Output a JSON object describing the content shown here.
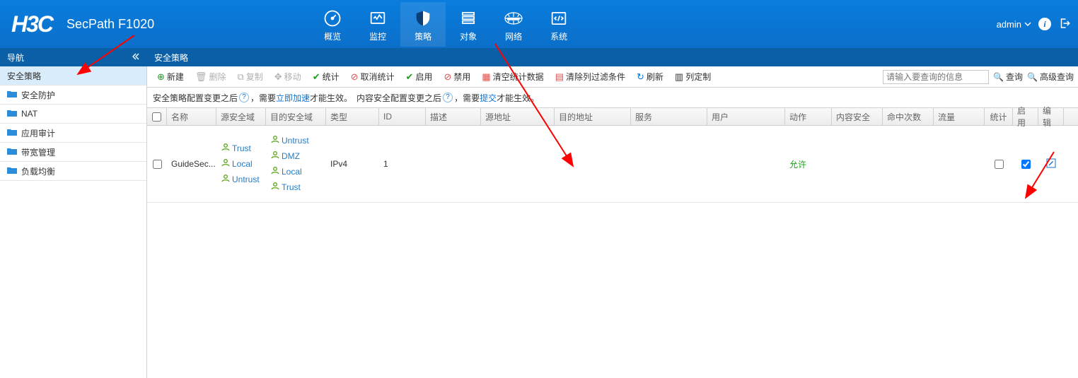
{
  "header": {
    "logo": "H3C",
    "product": "SecPath F1020",
    "user": "admin"
  },
  "topnav": [
    {
      "label": "概览",
      "icon": "gauge"
    },
    {
      "label": "监控",
      "icon": "monitor"
    },
    {
      "label": "策略",
      "icon": "shield",
      "active": true
    },
    {
      "label": "对象",
      "icon": "stack"
    },
    {
      "label": "网络",
      "icon": "globe"
    },
    {
      "label": "系统",
      "icon": "code"
    }
  ],
  "sidebar": {
    "title": "导航",
    "items": [
      {
        "label": "安全策略",
        "active": true
      },
      {
        "label": "安全防护"
      },
      {
        "label": "NAT"
      },
      {
        "label": "应用审计"
      },
      {
        "label": "带宽管理"
      },
      {
        "label": "负载均衡"
      }
    ]
  },
  "breadcrumb": "安全策略",
  "toolbar": {
    "new": "新建",
    "delete": "删除",
    "copy": "复制",
    "move": "移动",
    "stats": "统计",
    "unstats": "取消统计",
    "enable": "启用",
    "disable": "禁用",
    "clearstats": "清空统计数据",
    "clearfilter": "清除列过滤条件",
    "refresh": "刷新",
    "columns": "列定制",
    "search_placeholder": "请输入要查询的信息",
    "query": "查询",
    "advquery": "高级查询"
  },
  "hint": {
    "t1": "安全策略配置变更之后 ",
    "t2": "，需要 ",
    "link1": "立即加速",
    "t3": " 才能生效。　内容安全配置变更之后 ",
    "link2": "提交",
    "t4": " 才能生效。"
  },
  "columns": {
    "name": "名称",
    "srczone": "源安全域",
    "dstzone": "目的安全域",
    "type": "类型",
    "id": "ID",
    "desc": "描述",
    "saddr": "源地址",
    "daddr": "目的地址",
    "svc": "服务",
    "user": "用户",
    "action": "动作",
    "content": "内容安全",
    "hits": "命中次数",
    "traffic": "流量",
    "stats": "统计",
    "enable": "启用",
    "edit": "编辑"
  },
  "rows": [
    {
      "name": "GuideSec...",
      "srczones": [
        "Trust",
        "Local",
        "Untrust"
      ],
      "dstzones": [
        "Untrust",
        "DMZ",
        "Local",
        "Trust"
      ],
      "type": "IPv4",
      "id": "1",
      "action": "允许",
      "stats": false,
      "enable": true
    }
  ]
}
